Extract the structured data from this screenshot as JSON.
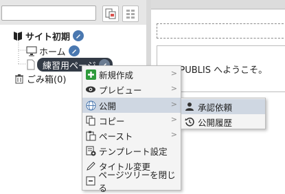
{
  "toolbar": {
    "search_placeholder": "",
    "icons": [
      "page-tree-icon",
      "grid-view-icon"
    ]
  },
  "tree": {
    "root": {
      "label": "サイト初期"
    },
    "home": {
      "label": "ホーム"
    },
    "page": {
      "label": "練習用ページ"
    },
    "trash": {
      "label": "ごみ箱(0)"
    }
  },
  "preview": {
    "welcome": "SITE PUBLIS へようこそ。"
  },
  "context_menu": {
    "items": [
      {
        "label": "新規作成",
        "icon": "plus-icon",
        "submenu": true
      },
      {
        "label": "プレビュー",
        "icon": "eye-icon",
        "submenu": true
      },
      {
        "label": "公開",
        "icon": "globe-icon",
        "submenu": true
      },
      {
        "label": "コピー",
        "icon": "copy-icon",
        "submenu": true
      },
      {
        "label": "ペースト",
        "icon": "paste-icon",
        "submenu": true
      },
      {
        "label": "テンプレート設定",
        "icon": "template-icon",
        "submenu": false
      },
      {
        "label": "タイトル変更",
        "icon": "pencil-icon",
        "submenu": false
      },
      {
        "label": "ページツリーを閉じる",
        "icon": "minus-box-icon",
        "submenu": false
      }
    ],
    "arrow": ">"
  },
  "submenu": {
    "items": [
      {
        "label": "承認依頼",
        "icon": "person-icon"
      },
      {
        "label": "公開履歴",
        "icon": "history-icon"
      }
    ]
  },
  "colors": {
    "highlight": "#333b46",
    "menu_active": "#cfd7e2",
    "pencil_badge": "#4a78b0"
  }
}
